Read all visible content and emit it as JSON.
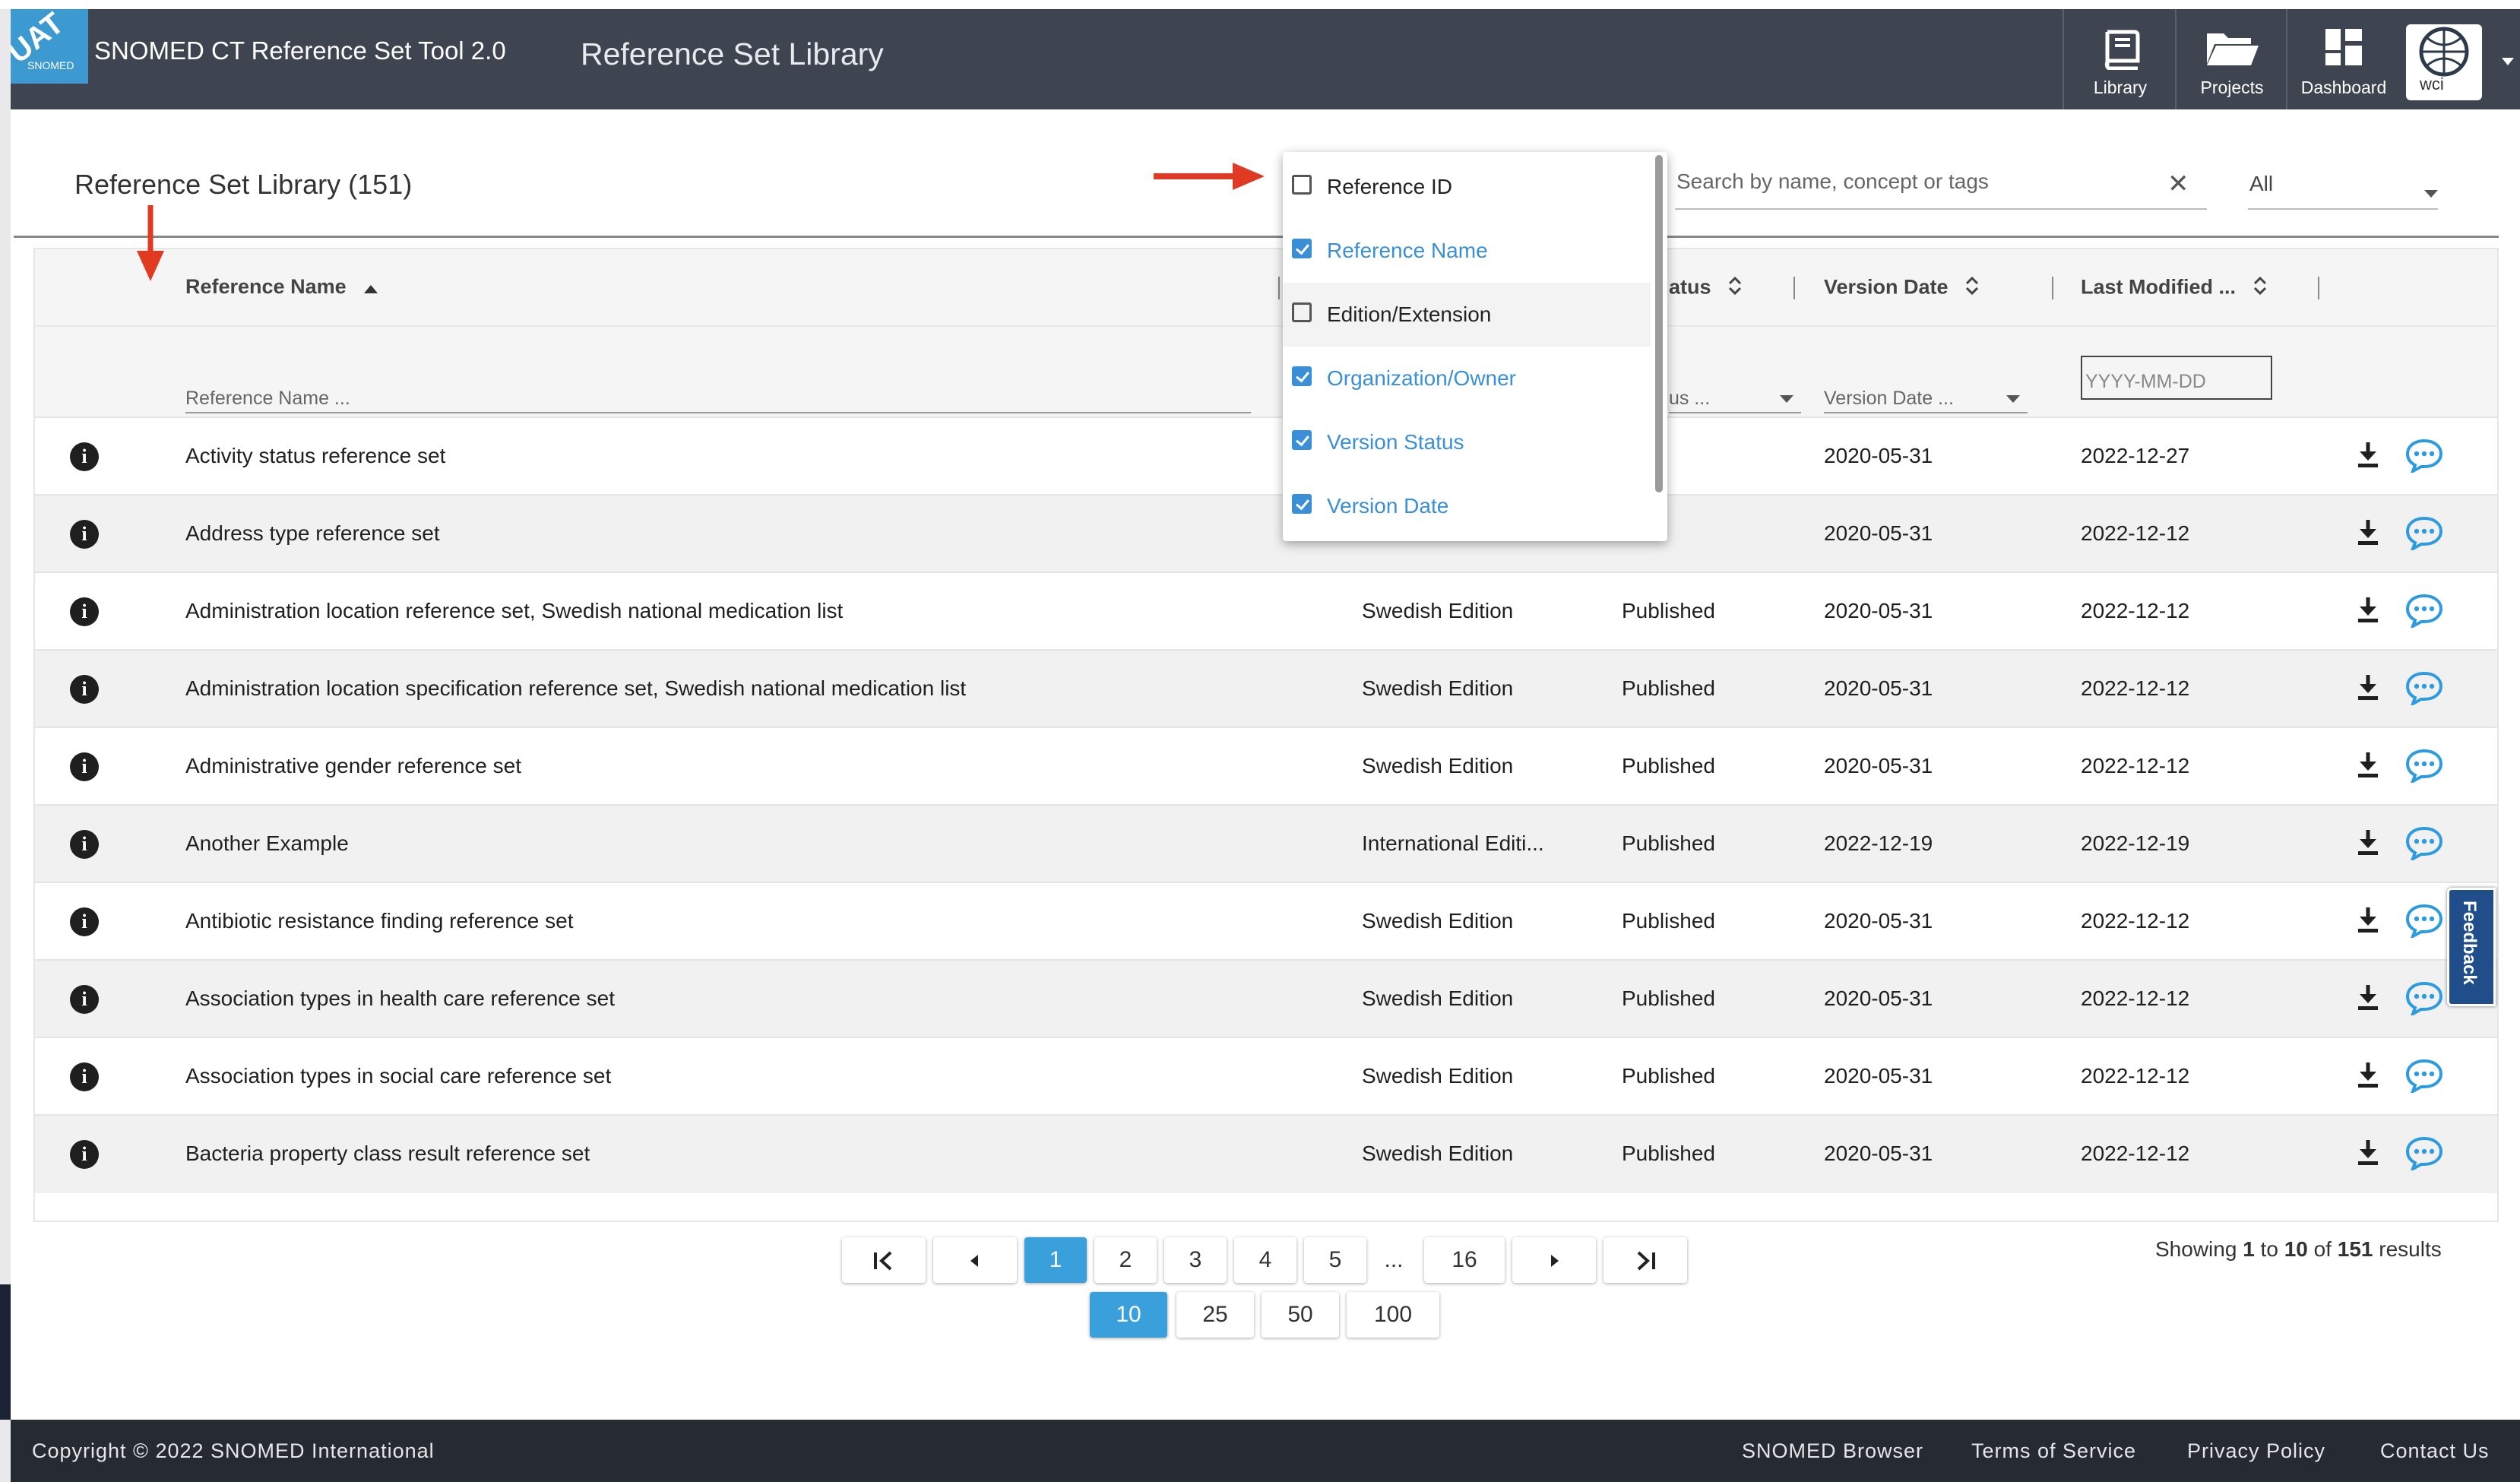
{
  "header": {
    "badge": "UAT",
    "logo_text": "SNOMED",
    "app_title": "SNOMED CT Reference Set Tool 2.0",
    "page_title": "Reference Set Library",
    "nav": [
      {
        "label": "Library",
        "icon": "book-icon"
      },
      {
        "label": "Projects",
        "icon": "folder-icon"
      },
      {
        "label": "Dashboard",
        "icon": "dashboard-icon"
      }
    ],
    "user": "wci"
  },
  "main": {
    "title": "Reference Set Library (151)",
    "search_placeholder": "Search by name, concept or tags",
    "scope_value": "All"
  },
  "table": {
    "headers": {
      "name": "Reference Name",
      "status": "atus",
      "version_date": "Version Date",
      "last_modified": "Last Modified ..."
    },
    "filters": {
      "name": "Reference Name ...",
      "status": "us ...",
      "version_date": "Version Date ...",
      "last_modified": "YYYY-MM-DD"
    },
    "rows": [
      {
        "name": "Activity status reference set",
        "edition": "",
        "status": "",
        "version_date": "2020-05-31",
        "last_modified": "2022-12-27"
      },
      {
        "name": "Address type reference set",
        "edition": "",
        "status": "",
        "version_date": "2020-05-31",
        "last_modified": "2022-12-12"
      },
      {
        "name": "Administration location reference set, Swedish national medication list",
        "edition": "Swedish Edition",
        "status": "Published",
        "version_date": "2020-05-31",
        "last_modified": "2022-12-12"
      },
      {
        "name": "Administration location specification reference set, Swedish national medication list",
        "edition": "Swedish Edition",
        "status": "Published",
        "version_date": "2020-05-31",
        "last_modified": "2022-12-12"
      },
      {
        "name": "Administrative gender reference set",
        "edition": "Swedish Edition",
        "status": "Published",
        "version_date": "2020-05-31",
        "last_modified": "2022-12-12"
      },
      {
        "name": "Another Example",
        "edition": "International Editi...",
        "status": "Published",
        "version_date": "2022-12-19",
        "last_modified": "2022-12-19"
      },
      {
        "name": "Antibiotic resistance finding reference set",
        "edition": "Swedish Edition",
        "status": "Published",
        "version_date": "2020-05-31",
        "last_modified": "2022-12-12"
      },
      {
        "name": "Association types in health care reference set",
        "edition": "Swedish Edition",
        "status": "Published",
        "version_date": "2020-05-31",
        "last_modified": "2022-12-12"
      },
      {
        "name": "Association types in social care reference set",
        "edition": "Swedish Edition",
        "status": "Published",
        "version_date": "2020-05-31",
        "last_modified": "2022-12-12"
      },
      {
        "name": "Bacteria property class result reference set",
        "edition": "Swedish Edition",
        "status": "Published",
        "version_date": "2020-05-31",
        "last_modified": "2022-12-12"
      }
    ]
  },
  "column_chooser": {
    "options": [
      {
        "label": "Reference ID",
        "checked": false
      },
      {
        "label": "Reference Name",
        "checked": true
      },
      {
        "label": "Edition/Extension",
        "checked": false
      },
      {
        "label": "Organization/Owner",
        "checked": true
      },
      {
        "label": "Version Status",
        "checked": true
      },
      {
        "label": "Version Date",
        "checked": true
      }
    ]
  },
  "pagination": {
    "pages": [
      "1",
      "2",
      "3",
      "4",
      "5",
      "...",
      "16"
    ],
    "current": "1",
    "page_sizes": [
      "10",
      "25",
      "50",
      "100"
    ],
    "current_size": "10",
    "showing_prefix": "Showing",
    "from": "1",
    "to_word": "to",
    "to": "10",
    "of_word": "of",
    "total": "151",
    "suffix": "results"
  },
  "feedback_label": "Feedback",
  "footer": {
    "copyright": "Copyright © 2022 SNOMED International",
    "links": [
      "SNOMED Browser",
      "Terms of Service",
      "Privacy Policy",
      "Contact Us"
    ]
  },
  "colors": {
    "header_bg": "#3e4450",
    "accent": "#3aa0dc",
    "annotation_arrow": "#e03a22",
    "footer_bg": "#262a31"
  }
}
